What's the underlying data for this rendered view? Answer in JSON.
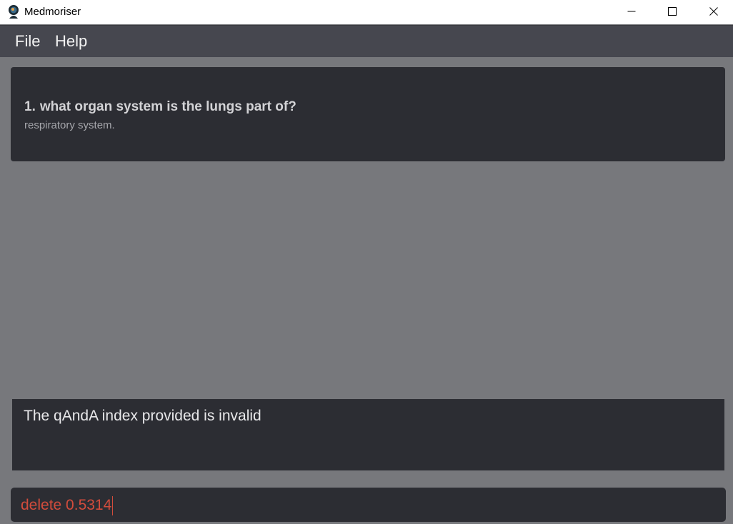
{
  "window": {
    "title": "Medmoriser",
    "controls": [
      "minimize-icon",
      "maximize-icon",
      "close-icon"
    ]
  },
  "menu": {
    "items": [
      {
        "label": "File"
      },
      {
        "label": "Help"
      }
    ]
  },
  "qanda_list": [
    {
      "index": "1.",
      "question": "what organ system is the lungs part of?",
      "answer": "respiratory system."
    }
  ],
  "result_display": {
    "message": "The qAndA index provided is invalid"
  },
  "command_box": {
    "value": "delete 0.5314"
  },
  "colors": {
    "background": "#77787c",
    "panel": "#2c2d33",
    "menubar": "#46474f",
    "error_text": "#d24c3c"
  }
}
